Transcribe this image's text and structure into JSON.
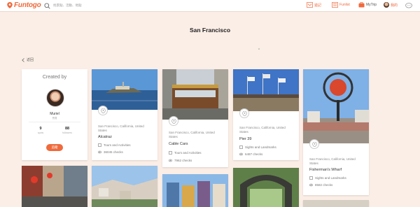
{
  "header": {
    "logo_text": "Funtogo",
    "search_placeholder": "找景點、活動、地點",
    "nav": [
      {
        "label": "遊記",
        "icon": "journal-icon"
      },
      {
        "label": "Funlist",
        "icon": "list-icon"
      },
      {
        "label": "MyTrip",
        "icon": "briefcase-icon"
      },
      {
        "label": "我的",
        "icon": "avatar"
      }
    ]
  },
  "page_title": "San Francisco",
  "back_label": "返回",
  "profile": {
    "created_by": "Created by",
    "name": "Muriel",
    "subtitle": "會員",
    "stats": [
      {
        "value": "9",
        "label": "spots"
      },
      {
        "value": "88",
        "label": "followers"
      }
    ],
    "follow_label": "追蹤"
  },
  "places": [
    {
      "location": "San Francisco, California, United States",
      "name": "Alcatraz",
      "category": "Tours and Activities",
      "checks": "36045 checks"
    },
    {
      "location": "San Francisco, California, United States",
      "name": "Cable Cars",
      "category": "Tours and Activities",
      "checks": "7962 checks"
    },
    {
      "location": "San Francisco, California, United States",
      "name": "Pier 39",
      "category": "Sights and Landmarks",
      "checks": "6487 checks"
    },
    {
      "location": "San Francisco, California, United States",
      "name": "Fisherman's Wharf",
      "category": "Sights and Landmarks",
      "checks": "8582 checks"
    }
  ],
  "colors": {
    "accent": "#ef6a3c",
    "background": "#fbeee6"
  }
}
